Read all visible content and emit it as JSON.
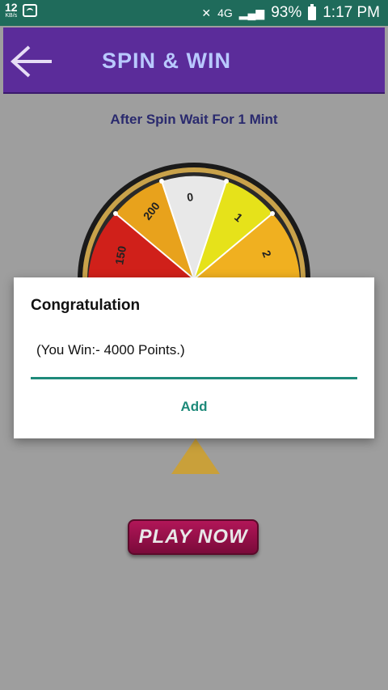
{
  "status_bar": {
    "speed_value": "12",
    "speed_unit": "KB/s",
    "network": "4G",
    "battery": "93%",
    "time": "1:17 PM"
  },
  "header": {
    "title": "SPIN & WIN",
    "back_icon": "arrow-left-icon"
  },
  "subtitle": "After Spin Wait For 1 Mint",
  "wheel": {
    "segment_labels": [
      "150",
      "200",
      "0",
      "1",
      "2"
    ],
    "colors": {
      "red": "#d0201a",
      "orange": "#e89a1c",
      "white": "#e8e8e8",
      "yellow": "#e6e21a"
    }
  },
  "play_button": {
    "label": "PLAY NOW"
  },
  "dialog": {
    "title": "Congratulation",
    "message": "(You Win:- 4000 Points.)",
    "action_label": "Add",
    "accent": "#1e8a7a"
  }
}
